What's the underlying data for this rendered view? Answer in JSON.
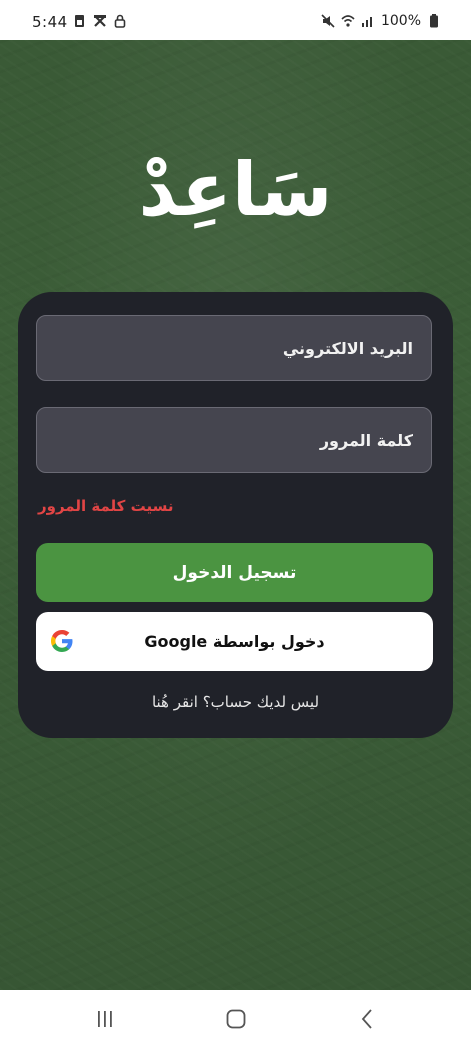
{
  "status_bar": {
    "time": "5:44",
    "battery_text": "100%",
    "left_icons": [
      "sim-icon",
      "tools-icon",
      "lock-icon"
    ],
    "right_icons": [
      "mute-icon",
      "wifi-icon",
      "signal-icon",
      "battery-icon"
    ]
  },
  "app": {
    "logo_text": "سَاعِدْ",
    "email_placeholder": "البريد الالكتروني",
    "password_placeholder": "كلمة المرور",
    "forgot_password": "نسيت كلمة المرور",
    "login_button": "تسجيل الدخول",
    "google_button": "دخول بواسطة Google",
    "signup_link": "ليس لديك حساب؟ انقر هُنا"
  },
  "colors": {
    "background": "#3b5b37",
    "card": "#202229",
    "field": "#45454f",
    "login_button": "#4b9441",
    "forgot_text": "#e14545"
  },
  "nav_bar": {
    "icons": [
      "recent-apps-icon",
      "home-icon",
      "back-icon"
    ]
  }
}
